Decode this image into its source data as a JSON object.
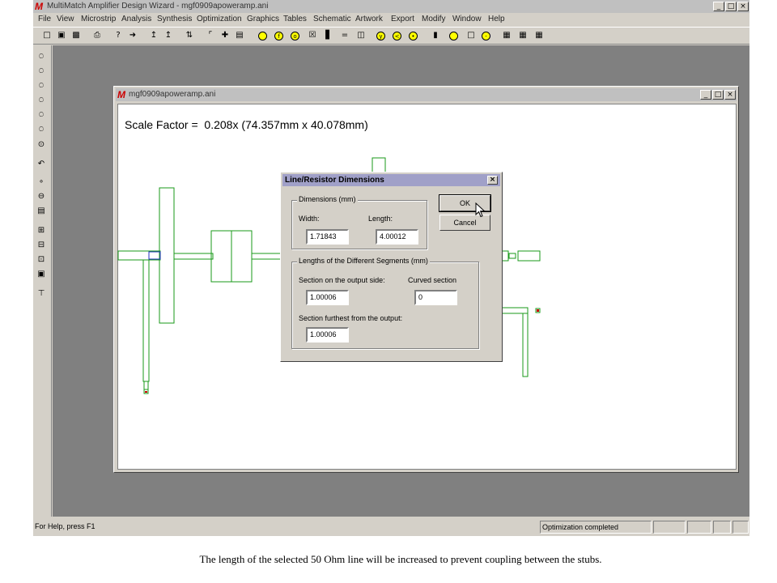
{
  "app": {
    "title": "MultiMatch Amplifier Design Wizard - mgf0909apoweramp.ani",
    "window_buttons": [
      "_",
      "□",
      "×"
    ]
  },
  "menu": [
    "File",
    "View",
    "Microstrip",
    "Analysis",
    "Synthesis",
    "Optimization",
    "Graphics",
    "Tables",
    "Schematic",
    "Artwork",
    "Export",
    "Modify",
    "Window",
    "Help"
  ],
  "child_window": {
    "title": "mgf0909apoweramp.ani",
    "scale_factor": "Scale Factor =  0.208x (74.357mm x 40.078mm)"
  },
  "dialog": {
    "title": "Line/Resistor Dimensions",
    "dimensions_group": "Dimensions (mm)",
    "width_label": "Width:",
    "width_value": "1.71843",
    "length_label": "Length:",
    "length_value": "4.00012",
    "segments_group": "Lengths of the Different Segments (mm)",
    "output_side_label": "Section on the output side:",
    "output_side_value": "1.00006",
    "curved_label": "Curved section",
    "curved_value": "0",
    "furthest_label": "Section furthest from the output:",
    "furthest_value": "1.00006",
    "ok_label": "OK",
    "cancel_label": "Cancel"
  },
  "status": {
    "help": "For Help, press F1",
    "message": "Optimization completed"
  },
  "caption": "The length of the selected 50 Ohm line will be increased to prevent coupling between the stubs.",
  "colors": {
    "schematic_line": "#1a9a1a",
    "mdi_background": "#808080",
    "window_face": "#d4d0c8"
  }
}
